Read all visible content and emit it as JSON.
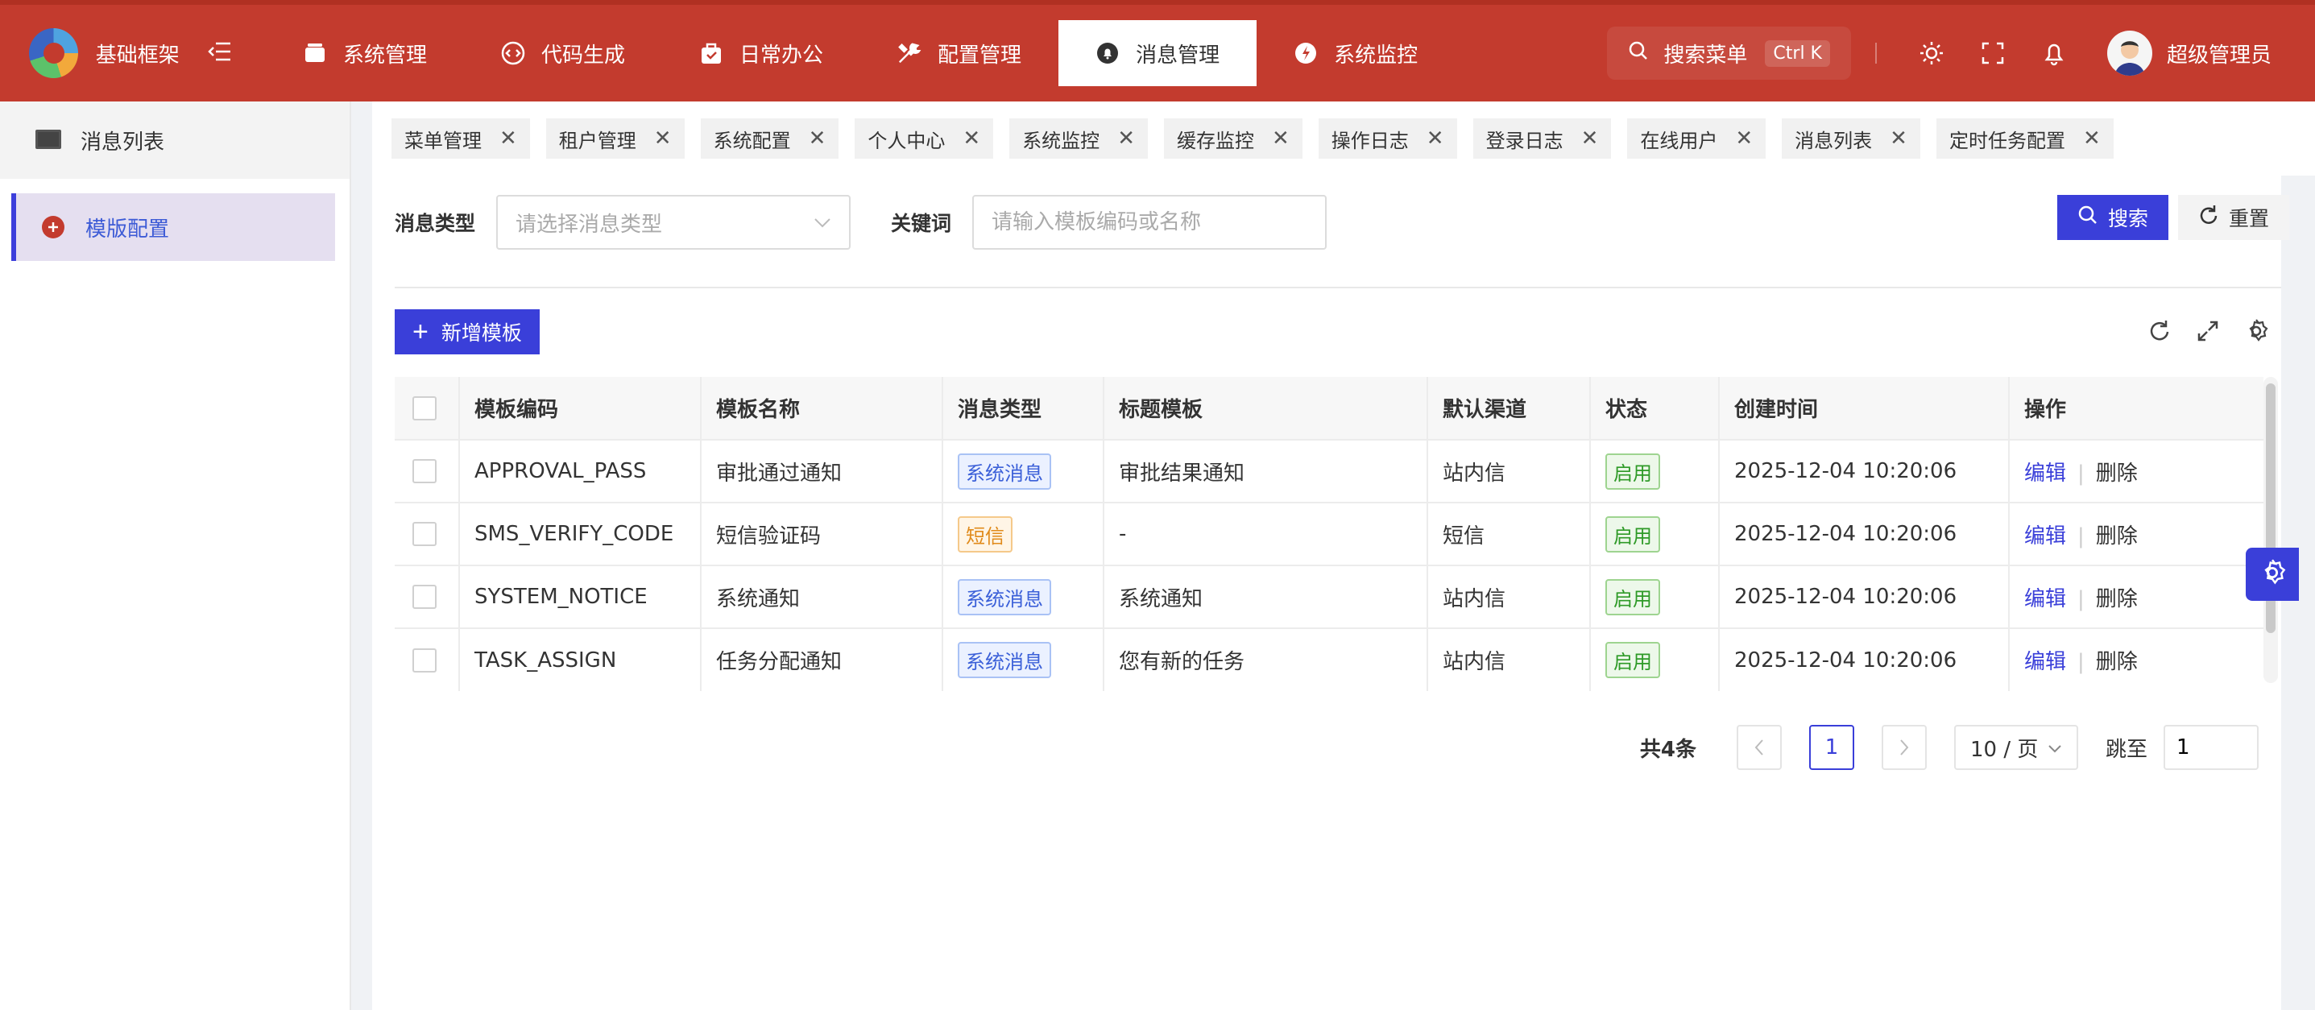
{
  "brand": {
    "name": "基础框架"
  },
  "topnav": [
    {
      "label": "系统管理",
      "icon": "box-icon"
    },
    {
      "label": "代码生成",
      "icon": "code-icon"
    },
    {
      "label": "日常办公",
      "icon": "briefcase-icon"
    },
    {
      "label": "配置管理",
      "icon": "tools-icon"
    },
    {
      "label": "消息管理",
      "icon": "bell-circle-icon",
      "active": true
    },
    {
      "label": "系统监控",
      "icon": "monitor-circle-icon"
    }
  ],
  "header": {
    "search_label": "搜索菜单",
    "search_shortcut": "Ctrl K",
    "user_name": "超级管理员"
  },
  "sidebar": {
    "items": [
      {
        "label": "消息列表",
        "icon": "monitor-icon"
      },
      {
        "label": "模版配置",
        "icon": "plus-circle-icon",
        "active": true
      }
    ]
  },
  "tabs": [
    "菜单管理",
    "租户管理",
    "系统配置",
    "个人中心",
    "系统监控",
    "缓存监控",
    "操作日志",
    "登录日志",
    "在线用户",
    "消息列表",
    "定时任务配置"
  ],
  "filters": {
    "type_label": "消息类型",
    "type_placeholder": "请选择消息类型",
    "keyword_label": "关键词",
    "keyword_placeholder": "请输入模板编码或名称",
    "search_label": "搜索",
    "reset_label": "重置"
  },
  "toolbar": {
    "add_label": "新增模板"
  },
  "table": {
    "columns": [
      "模板编码",
      "模板名称",
      "消息类型",
      "标题模板",
      "默认渠道",
      "状态",
      "创建时间",
      "操作"
    ],
    "rows": [
      {
        "code": "APPROVAL_PASS",
        "name": "审批通过通知",
        "type": "系统消息",
        "type_color": "blue",
        "title": "审批结果通知",
        "channel": "站内信",
        "status": "启用",
        "created": "2025-12-04 10:20:06"
      },
      {
        "code": "SMS_VERIFY_CODE",
        "name": "短信验证码",
        "type": "短信",
        "type_color": "orange",
        "title": "-",
        "channel": "短信",
        "status": "启用",
        "created": "2025-12-04 10:20:06"
      },
      {
        "code": "SYSTEM_NOTICE",
        "name": "系统通知",
        "type": "系统消息",
        "type_color": "blue",
        "title": "系统通知",
        "channel": "站内信",
        "status": "启用",
        "created": "2025-12-04 10:20:06"
      },
      {
        "code": "TASK_ASSIGN",
        "name": "任务分配通知",
        "type": "系统消息",
        "type_color": "blue",
        "title": "您有新的任务",
        "channel": "站内信",
        "status": "启用",
        "created": "2025-12-04 10:20:06"
      }
    ],
    "edit_label": "编辑",
    "delete_label": "删除"
  },
  "pagination": {
    "total_text": "共4条",
    "current_page": "1",
    "page_size": "10 / 页",
    "jump_label": "跳至",
    "jump_value": "1"
  },
  "colors": {
    "header_bg": "#c33b2e",
    "primary": "#3a3fd9",
    "success": "#2e9a27",
    "warning": "#e08a1a"
  }
}
